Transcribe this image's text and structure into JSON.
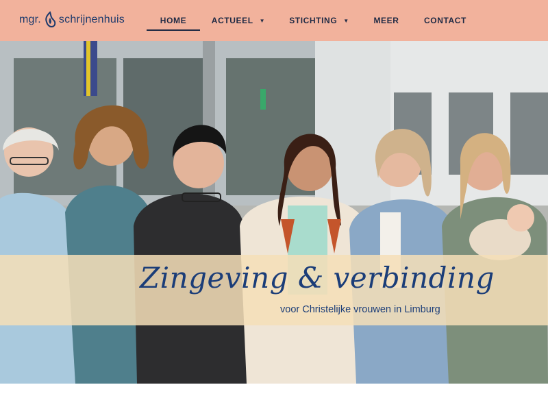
{
  "logo": {
    "prefix": "mgr.",
    "name": "schrijnenhuis",
    "mark": "flame-icon"
  },
  "nav": {
    "items": [
      {
        "label": "HOME",
        "active": true
      },
      {
        "label": "ACTUEEL",
        "dropdown": true
      },
      {
        "label": "STICHTING",
        "dropdown": true
      },
      {
        "label": "MEER"
      },
      {
        "label": "CONTACT"
      }
    ],
    "caret_icon": "caret-down-icon"
  },
  "hero": {
    "title": "Zingeving & verbinding",
    "subtitle": "voor Christelijke vrouwen in Limburg"
  },
  "colors": {
    "header_bg": "#f2b29c",
    "nav_text": "#1f2a44",
    "banner_bg": "#f5deb8",
    "banner_text": "#1b3d78"
  }
}
